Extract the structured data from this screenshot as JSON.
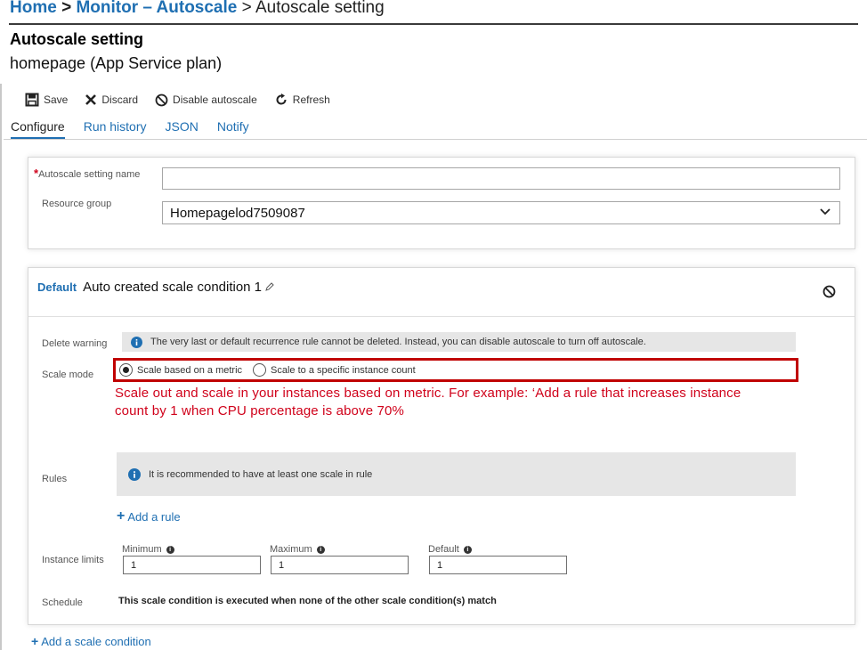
{
  "breadcrumb": {
    "home": "Home",
    "sep1": ">",
    "monitor": "Monitor – Autoscale",
    "sep2": ">",
    "current": "Autoscale setting"
  },
  "page": {
    "title": "Autoscale setting",
    "subtitle": "homepage (App Service plan)"
  },
  "toolbar": {
    "save": "Save",
    "discard": "Discard",
    "disable": "Disable autoscale",
    "refresh": "Refresh"
  },
  "tabs": [
    "Configure",
    "Run history",
    "JSON",
    "Notify"
  ],
  "settings": {
    "name_label": "Autoscale setting name",
    "name_required": "*",
    "name_value": "",
    "rg_label": "Resource group",
    "rg_value": "Homepagelod7509087"
  },
  "condition": {
    "default_tag": "Default",
    "name": "Auto created scale condition 1",
    "delete_warning_label": "Delete warning",
    "delete_warning_text": "The very last or default recurrence rule cannot be deleted. Instead, you can disable autoscale to turn off autoscale.",
    "scale_mode_label": "Scale mode",
    "scale_mode_options": [
      "Scale based on a metric",
      "Scale to a specific instance count"
    ],
    "scale_mode_selected": "Scale based on a metric",
    "annotation_line1": "Scale out and scale in your instances based on metric. For example: ‘Add a rule that increases instance",
    "annotation_line2": "count by 1 when CPU percentage is above 70%",
    "rules_label": "Rules",
    "rules_info": "It is recommended to have at least one scale in rule",
    "add_rule": "Add a rule",
    "instance_limits_label": "Instance limits",
    "minimum_label": "Minimum",
    "minimum_value": "1",
    "maximum_label": "Maximum",
    "maximum_value": "1",
    "default_label": "Default",
    "default_value": "1",
    "schedule_label": "Schedule",
    "schedule_text": "This scale condition is executed when none of the other scale condition(s) match"
  },
  "footer": {
    "add_condition": "Add a scale condition"
  },
  "colors": {
    "link_blue": "#1f6fb2",
    "annotation_red": "#d0021b",
    "highlight_border": "#c00000"
  }
}
